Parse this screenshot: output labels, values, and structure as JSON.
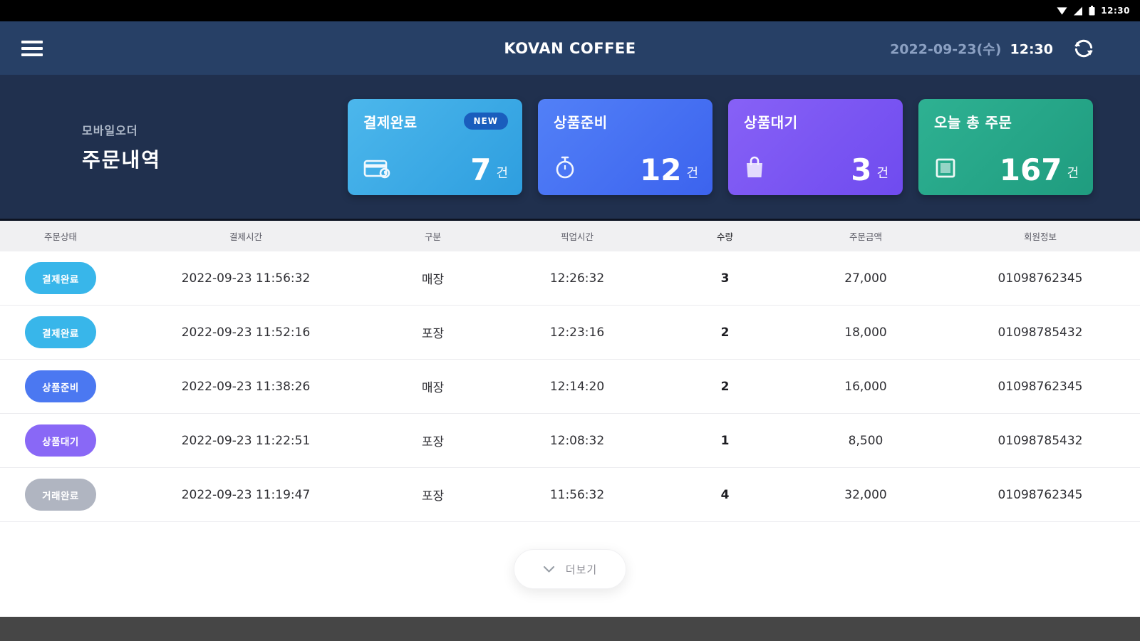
{
  "status_bar": {
    "time": "12:30",
    "icons": [
      "wifi-icon",
      "cellular-signal-icon",
      "battery-icon"
    ]
  },
  "header": {
    "title": "KOVAN COFFEE",
    "date": "2022-09-23(수)",
    "time": "12:30"
  },
  "overview": {
    "subtitle": "모바일오더",
    "title": "주문내역",
    "cards": [
      {
        "label": "결제완료",
        "badge": "NEW",
        "count": "7",
        "unit": "건",
        "icon": "credit-card-icon",
        "color_from": "#4cb7ec",
        "color_to": "#2e9edf"
      },
      {
        "label": "상품준비",
        "count": "12",
        "unit": "건",
        "icon": "stopwatch-icon",
        "color_from": "#5280f7",
        "color_to": "#3c63ee"
      },
      {
        "label": "상품대기",
        "count": "3",
        "unit": "건",
        "icon": "shopping-bag-icon",
        "color_from": "#8761f6",
        "color_to": "#6f4bef"
      },
      {
        "label": "오늘 총 주문",
        "count": "167",
        "unit": "건",
        "icon": "order-list-icon",
        "color_from": "#2eb192",
        "color_to": "#1f9c7f"
      }
    ]
  },
  "table": {
    "columns": [
      "주문상태",
      "결제시간",
      "구분",
      "픽업시간",
      "수량",
      "주문금액",
      "회원정보"
    ],
    "rows": [
      {
        "status": "결제완료",
        "status_color": "#38b6ea",
        "paid_at": "2022-09-23 11:56:32",
        "type": "매장",
        "pickup_at": "12:26:32",
        "qty": "3",
        "amount": "27,000",
        "member": "01098762345"
      },
      {
        "status": "결제완료",
        "status_color": "#38b6ea",
        "paid_at": "2022-09-23 11:52:16",
        "type": "포장",
        "pickup_at": "12:23:16",
        "qty": "2",
        "amount": "18,000",
        "member": "01098785432"
      },
      {
        "status": "상품준비",
        "status_color": "#4b78f1",
        "paid_at": "2022-09-23 11:38:26",
        "type": "매장",
        "pickup_at": "12:14:20",
        "qty": "2",
        "amount": "16,000",
        "member": "01098762345"
      },
      {
        "status": "상품대기",
        "status_color": "#8968f6",
        "paid_at": "2022-09-23 11:22:51",
        "type": "포장",
        "pickup_at": "12:08:32",
        "qty": "1",
        "amount": "8,500",
        "member": "01098785432"
      },
      {
        "status": "거래완료",
        "status_color": "#b0b5c1",
        "paid_at": "2022-09-23 11:19:47",
        "type": "포장",
        "pickup_at": "11:56:32",
        "qty": "4",
        "amount": "32,000",
        "member": "01098762345"
      }
    ],
    "more_label": "더보기"
  }
}
